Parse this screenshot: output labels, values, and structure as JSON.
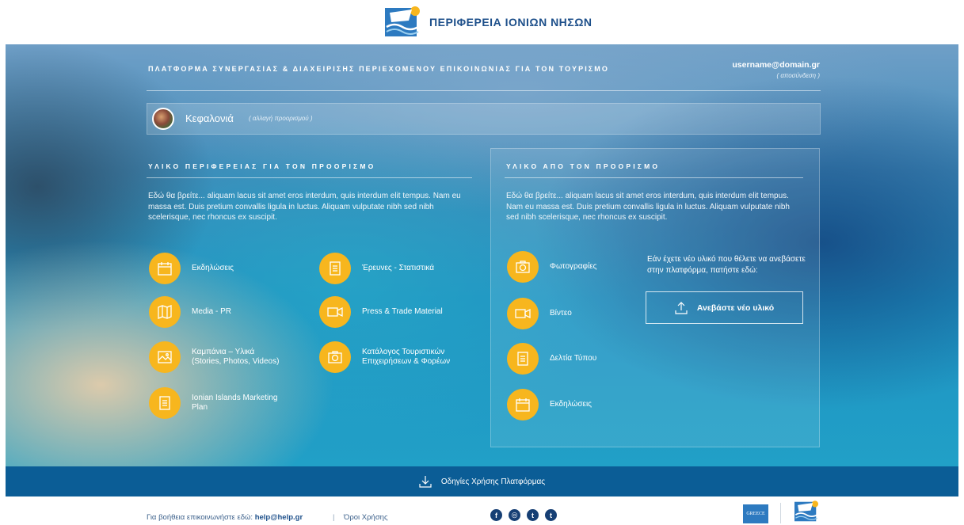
{
  "header": {
    "logo_icon": "ionian-islands-logo",
    "title": "ΠΕΡΙΦΕΡΕΙΑ ΙΟΝΙΩΝ ΝΗΣΩΝ",
    "brand_color": "#1d4f8a"
  },
  "platform": {
    "title": "ΠΛΑΤΦΟΡΜΑ ΣΥΝΕΡΓΑΣΙΑΣ & ΔΙΑΧΕΙΡΙΣΗΣ ΠΕΡΙΕΧΟΜΕΝΟΥ ΕΠΙΚΟΙΝΩΝΙΑΣ ΓΙΑ ΤΟΝ ΤΟΥΡΙΣΜΟ",
    "user_email": "username@domain.gr",
    "logout_label": "( αποσύνδεση )"
  },
  "destination": {
    "name": "Κεφαλονιά",
    "change_label": "( αλλαγή προορισμού )"
  },
  "left_section": {
    "title": "ΥΛΙΚΟ ΠΕΡΙΦΕΡΕΙΑΣ ΓΙΑ ΤΟΝ ΠΡΟΟΡΙΣΜΟ",
    "description": "Εδώ θα βρείτε... aliquam lacus sit amet eros interdum, quis interdum elit tempus. Nam eu massa est. Duis pretium convallis ligula in luctus. Aliquam vulputate nibh sed nibh scelerisque, nec rhoncus ex suscipit.",
    "items": [
      {
        "label": "Εκδηλώσεις",
        "icon": "calendar-icon"
      },
      {
        "label": "Έρευνες - Στατιστικά",
        "icon": "document-icon"
      },
      {
        "label": "Media - PR",
        "icon": "map-icon"
      },
      {
        "label": "Press & Trade Material",
        "icon": "video-icon"
      },
      {
        "label": "Καμπάνια – Υλικά\n(Stories, Photos, Videos)",
        "icon": "image-icon"
      },
      {
        "label": "Κατάλογος Τουριστικών\nΕπιχειρήσεων & Φορέων",
        "icon": "camera-icon"
      },
      {
        "label": "Ionian Islands Marketing\nPlan",
        "icon": "document-icon"
      }
    ]
  },
  "right_section": {
    "title": "ΥΛΙΚΟ ΑΠΟ ΤΟΝ ΠΡΟΟΡΙΣΜΟ",
    "description": "Εδώ θα βρείτε... aliquam lacus sit amet eros interdum, quis interdum elit tempus. Nam eu massa est. Duis pretium convallis ligula in luctus. Aliquam vulputate nibh sed nibh scelerisque, nec rhoncus ex suscipit.",
    "items": [
      {
        "label": "Φωτογραφίες",
        "icon": "camera-icon"
      },
      {
        "label": "Βίντεο",
        "icon": "video-icon"
      },
      {
        "label": "Δελτία Τύπου",
        "icon": "document-icon"
      },
      {
        "label": "Εκδηλώσεις",
        "icon": "calendar-icon"
      }
    ],
    "upload_text": "Εάν έχετε νέο υλικό που θέλετε να ανεβάσετε στην πλατφόρμα, πατήστε εδώ:",
    "upload_button": "Ανεβάστε νέο υλικό"
  },
  "guide": {
    "label": "Οδηγίες Χρήσης Πλατφόρμας",
    "bar_color": "#0b5d96"
  },
  "footer": {
    "help_prefix": "Για βοήθεια επικοινωνήστε εδώ:",
    "help_email": "help@help.gr",
    "separator": "|",
    "terms": "Όροι Χρήσης",
    "socials": [
      {
        "icon": "facebook-icon",
        "glyph": "f"
      },
      {
        "icon": "instagram-icon",
        "glyph": "◎"
      },
      {
        "icon": "twitter-icon",
        "glyph": "t"
      },
      {
        "icon": "tumblr-icon",
        "glyph": "t"
      }
    ],
    "greece_logo": "GREECE"
  },
  "colors": {
    "accent": "#f7b61e",
    "footer_text": "#1d4f8a"
  }
}
